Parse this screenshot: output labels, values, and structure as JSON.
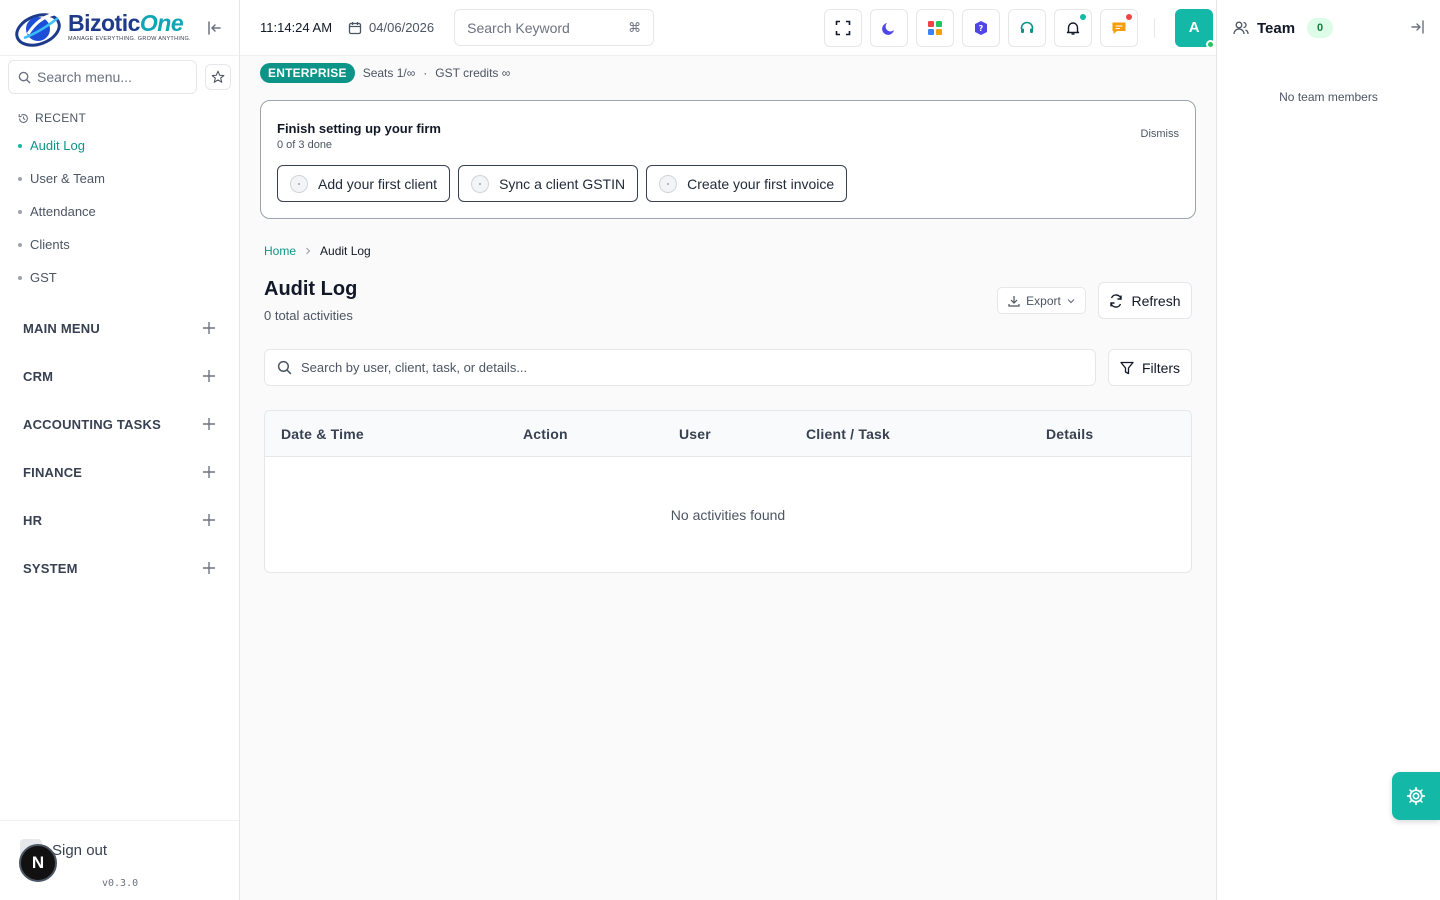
{
  "brand": {
    "name_main": "Bizotic",
    "name_accent": "One",
    "tagline": "MANAGE EVERYTHING. GROW ANYTHING."
  },
  "sidebar": {
    "search_placeholder": "Search menu...",
    "recent_label": "RECENT",
    "recent_items": [
      {
        "label": "Audit Log",
        "active": true
      },
      {
        "label": "User & Team",
        "active": false
      },
      {
        "label": "Attendance",
        "active": false
      },
      {
        "label": "Clients",
        "active": false
      },
      {
        "label": "GST",
        "active": false
      }
    ],
    "groups": [
      "MAIN MENU",
      "CRM",
      "ACCOUNTING TASKS",
      "FINANCE",
      "HR",
      "SYSTEM"
    ],
    "signout_label": "Sign out",
    "n_badge": "N",
    "version": "v0.3.0"
  },
  "topbar": {
    "time": "11:14:24 AM",
    "date": "04/06/2026",
    "search_placeholder": "Search Keyword",
    "shortcut": "⌘",
    "avatar_initial": "A",
    "colors": {
      "notify_dot": "#14b8a6",
      "alert_dot": "#ef4444",
      "avatar_bg": "#14b8a6"
    }
  },
  "plan": {
    "badge": "ENTERPRISE",
    "seats": "Seats 1/∞",
    "separator": "·",
    "gst": "GST credits ∞"
  },
  "setup": {
    "title": "Finish setting up your firm",
    "progress": "0 of 3 done",
    "dismiss": "Dismiss",
    "steps": [
      "Add your first client",
      "Sync a client GSTIN",
      "Create your first invoice"
    ]
  },
  "breadcrumb": {
    "home": "Home",
    "current": "Audit Log"
  },
  "page": {
    "title": "Audit Log",
    "subtitle": "0 total activities",
    "export_label": "Export",
    "refresh_label": "Refresh",
    "search_placeholder": "Search by user, client, task, or details...",
    "filters_label": "Filters"
  },
  "table": {
    "columns": [
      "Date & Time",
      "Action",
      "User",
      "Client / Task",
      "Details"
    ],
    "empty_text": "No activities found"
  },
  "team_panel": {
    "title": "Team",
    "count": "0",
    "empty_text": "No team members"
  },
  "accent_color": "#14b8a6"
}
